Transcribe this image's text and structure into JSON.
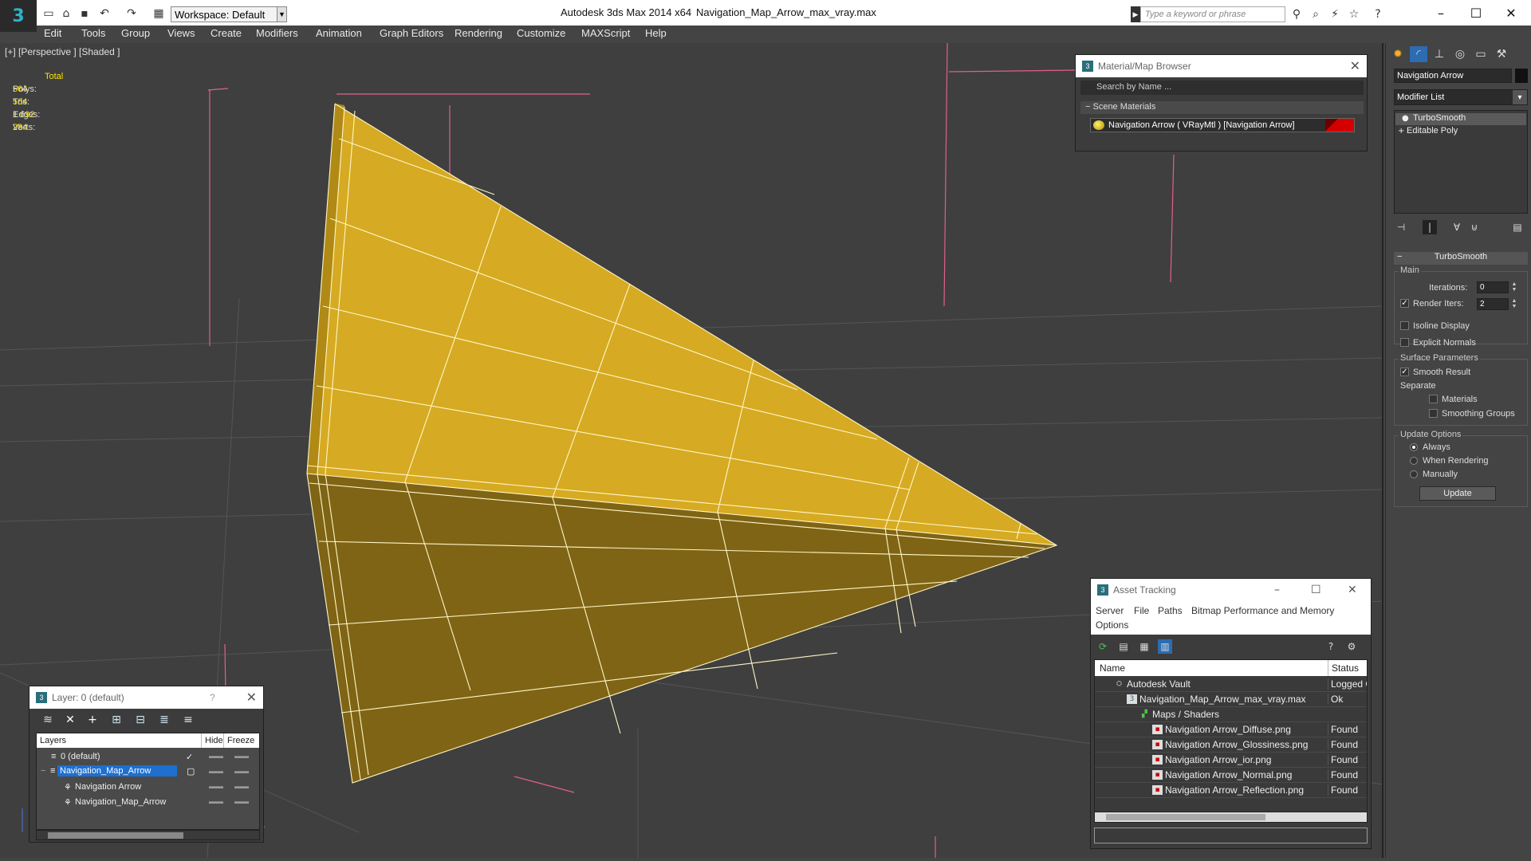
{
  "titlebar": {
    "workspace": "Workspace: Default",
    "app_title": "Autodesk 3ds Max  2014 x64",
    "file_title": "Navigation_Map_Arrow_max_vray.max",
    "search_placeholder": "Type a keyword or phrase"
  },
  "menu": [
    "Edit",
    "Tools",
    "Group",
    "Views",
    "Create",
    "Modifiers",
    "Animation",
    "Graph Editors",
    "Rendering",
    "Customize",
    "MAXScript",
    "Help"
  ],
  "viewport": {
    "label": "[+] [Perspective ] [Shaded ]",
    "stats": {
      "header": "Total",
      "polys_label": "Polys:",
      "polys": "564",
      "tris_label": "Tris:",
      "tris": "564",
      "edges_label": "Edges:",
      "edges": "1 692",
      "verts_label": "Verts:",
      "verts": "284"
    },
    "object_color": "#d9ae28",
    "wire_color": "#fff7c8"
  },
  "material_browser": {
    "title": "Material/Map Browser",
    "search": "Search by Name ...",
    "section": "Scene Materials",
    "material": "Navigation Arrow  ( VRayMtl )  [Navigation Arrow]"
  },
  "command_panel": {
    "object_name": "Navigation Arrow",
    "modifier_list": "Modifier List",
    "stack": [
      "TurboSmooth",
      "Editable Poly"
    ],
    "rollout": {
      "title": "TurboSmooth",
      "main": "Main",
      "iterations_label": "Iterations:",
      "iterations": "0",
      "render_iters_label": "Render Iters:",
      "render_iters": "2",
      "isoline": "Isoline Display",
      "explicit_normals": "Explicit Normals",
      "surface_params": "Surface Parameters",
      "smooth_result": "Smooth Result",
      "separate": "Separate",
      "materials": "Materials",
      "smoothing_groups": "Smoothing Groups",
      "update_options": "Update Options",
      "always": "Always",
      "when_rendering": "When Rendering",
      "manually": "Manually",
      "update": "Update"
    }
  },
  "layer_window": {
    "title": "Layer: 0 (default)",
    "help": "?",
    "col_layers": "Layers",
    "col_hide": "Hide",
    "col_freeze": "Freeze",
    "rows": [
      "0 (default)",
      "Navigation_Map_Arrow",
      "Navigation Arrow",
      "Navigation_Map_Arrow"
    ]
  },
  "asset_tracking": {
    "title": "Asset Tracking",
    "menu": [
      "Server",
      "File",
      "Paths",
      "Bitmap Performance and Memory",
      "Options"
    ],
    "col_name": "Name",
    "col_status": "Status",
    "rows": [
      {
        "name": "Autodesk Vault",
        "status": "Logged Out"
      },
      {
        "name": "Navigation_Map_Arrow_max_vray.max",
        "status": "Ok"
      },
      {
        "name": "Maps / Shaders",
        "status": ""
      },
      {
        "name": "Navigation Arrow_Diffuse.png",
        "status": "Found"
      },
      {
        "name": "Navigation Arrow_Glossiness.png",
        "status": "Found"
      },
      {
        "name": "Navigation Arrow_ior.png",
        "status": "Found"
      },
      {
        "name": "Navigation Arrow_Normal.png",
        "status": "Found"
      },
      {
        "name": "Navigation Arrow_Reflection.png",
        "status": "Found"
      }
    ]
  }
}
